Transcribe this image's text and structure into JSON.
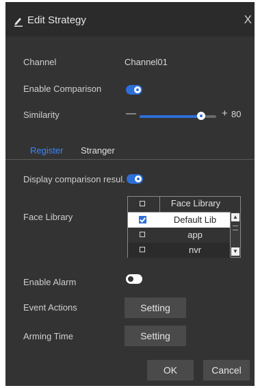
{
  "dialog": {
    "title": "Edit Strategy",
    "close_symbol": "X"
  },
  "fields": {
    "channel_label": "Channel",
    "channel_value": "Channel01",
    "enable_comparison_label": "Enable Comparison",
    "enable_comparison_on": true,
    "similarity_label": "Similarity",
    "similarity_minus": "—",
    "similarity_plus": "+",
    "similarity_value": "80",
    "similarity_fraction": 0.8
  },
  "tabs": [
    {
      "label": "Register",
      "active": true
    },
    {
      "label": "Stranger",
      "active": false
    }
  ],
  "register": {
    "display_comparison_label": "Display comparison resul.",
    "display_comparison_on": true,
    "face_library_label": "Face Library",
    "face_library_table": {
      "header": "Face Library",
      "rows": [
        {
          "name": "Default Lib",
          "checked": true,
          "selected": true
        },
        {
          "name": "app",
          "checked": false,
          "selected": false
        },
        {
          "name": "nvr",
          "checked": false,
          "selected": false
        }
      ]
    },
    "enable_alarm_label": "Enable Alarm",
    "enable_alarm_on": false,
    "event_actions_label": "Event Actions",
    "event_actions_button": "Setting",
    "arming_time_label": "Arming Time",
    "arming_time_button": "Setting"
  },
  "footer": {
    "ok_label": "OK",
    "cancel_label": "Cancel"
  },
  "colors": {
    "accent": "#2d6fd8",
    "tab_active": "#3a86ff",
    "dialog_bg": "#333333",
    "button_bg": "#4a4a4a"
  },
  "icons": [
    "edit-pencil-icon",
    "close-icon",
    "checkbox-icon",
    "scroll-up-icon",
    "scroll-down-icon"
  ]
}
